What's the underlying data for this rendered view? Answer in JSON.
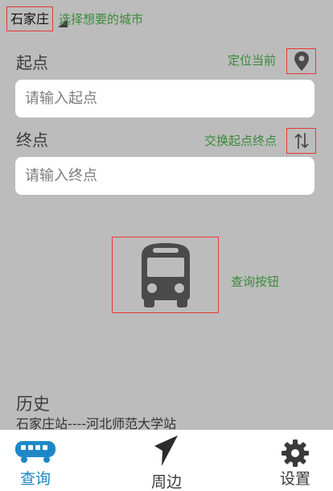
{
  "header": {
    "city": "石家庄",
    "city_hint": "选择想要的城市"
  },
  "start": {
    "label": "起点",
    "placeholder": "请输入起点",
    "locate_hint": "定位当前"
  },
  "end": {
    "label": "终点",
    "placeholder": "请输入终点",
    "swap_hint": "交换起点终点"
  },
  "query": {
    "hint": "查询按钮"
  },
  "history": {
    "title": "历史",
    "items": [
      "石家庄站----河北师范大学站"
    ]
  },
  "nav": {
    "items": [
      {
        "label": "查询",
        "icon": "bus-front-icon",
        "active": true
      },
      {
        "label": "周边",
        "icon": "navigation-arrow-icon",
        "active": false
      },
      {
        "label": "设置",
        "icon": "gear-icon",
        "active": false
      }
    ]
  },
  "colors": {
    "background": "#bcbcbc",
    "annotation": "#3a8a3a",
    "highlight_box": "#e53935",
    "active_tab": "#1e88c7",
    "icon_dark": "#4a4a4a"
  }
}
